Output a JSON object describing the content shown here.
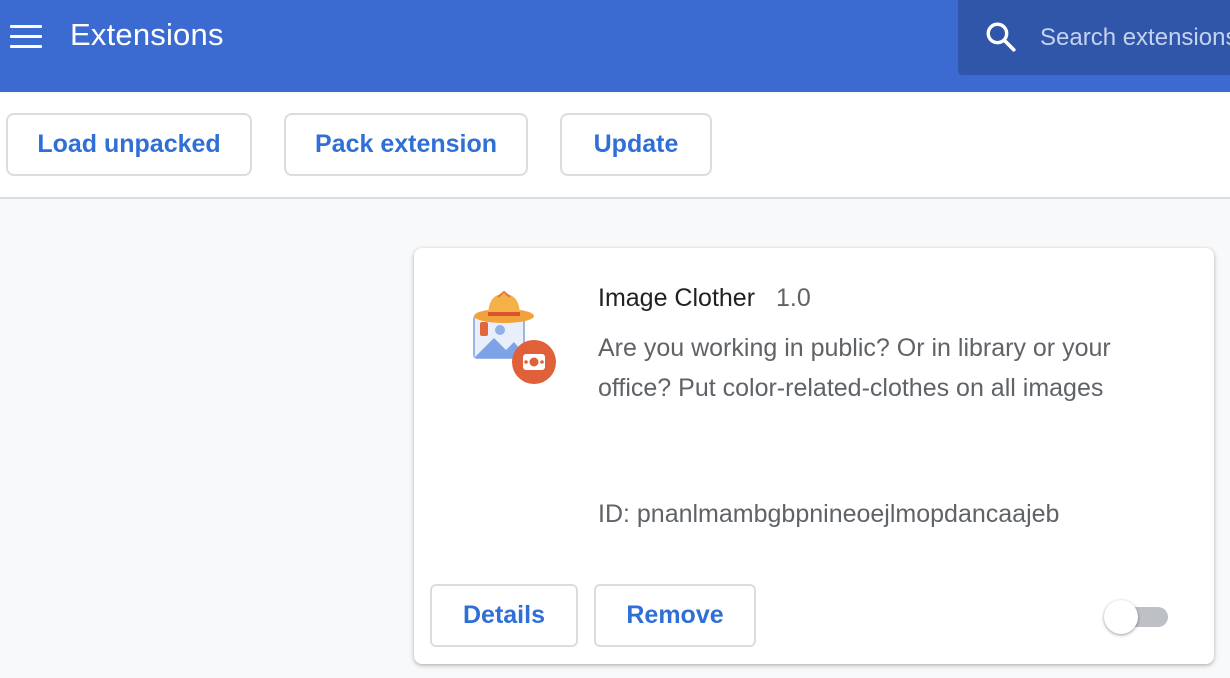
{
  "header": {
    "title": "Extensions",
    "menu_icon": "hamburger-menu-icon",
    "search": {
      "placeholder": "Search extensions",
      "value": "",
      "icon": "search-icon"
    }
  },
  "toolbar": {
    "load_unpacked_label": "Load unpacked",
    "pack_extension_label": "Pack extension",
    "update_label": "Update"
  },
  "extension": {
    "name": "Image Clother",
    "version": "1.0",
    "description": "Are you working in public? Or in library or your office? Put color-related-clothes on all images",
    "id_text": "ID: pnanlmambgbpnineoejlmopdancaajeb",
    "icon": "image-clother-extension-icon",
    "details_label": "Details",
    "remove_label": "Remove",
    "enabled": false
  },
  "colors": {
    "header_bg": "#3b6bd0",
    "search_bg": "#2f56a8",
    "accent": "#2f6fd6",
    "page_bg": "#f8f9fa"
  }
}
